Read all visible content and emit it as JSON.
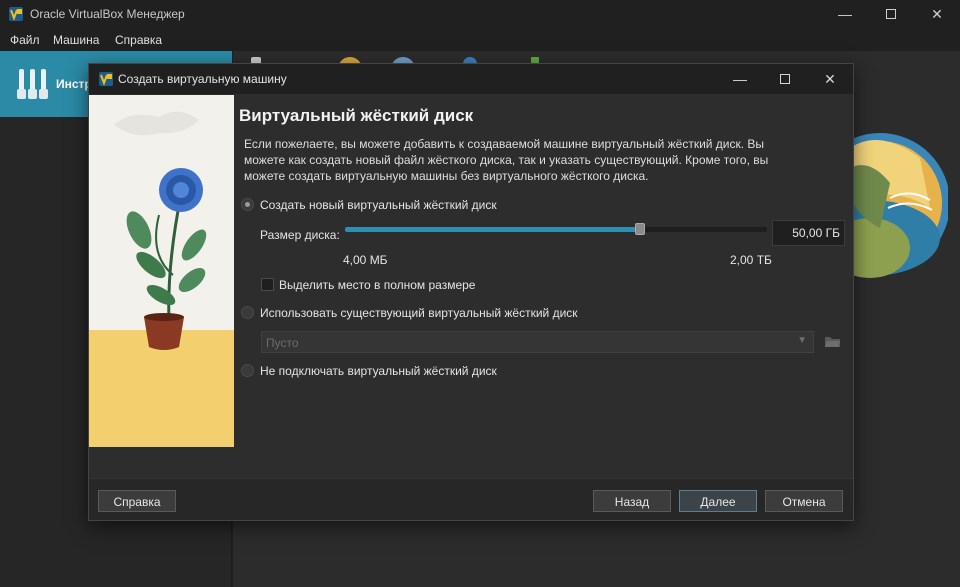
{
  "window": {
    "title": "Oracle VirtualBox Менеджер",
    "minimize_icon": "minimize-icon",
    "maximize_icon": "maximize-icon",
    "close_icon": "close-icon"
  },
  "menu": [
    "Файл",
    "Машина",
    "Справка"
  ],
  "sidebar": {
    "tools_label": "Инстр"
  },
  "dialog": {
    "title": "Создать виртуальную машину",
    "heading": "Виртуальный жёсткий диск",
    "description": "Если пожелаете, вы можете добавить к создаваемой машине виртуальный жёсткий диск. Вы можете как создать новый файл жёсткого диска, так и указать существующий. Кроме того, вы можете создать виртуальную машины без виртуального жёсткого диска.",
    "option_create": "Создать новый виртуальный жёсткий диск",
    "size_label": "Размер диска:",
    "size_value": "50,00 ГБ",
    "size_min": "4,00 МБ",
    "size_max": "2,00 ТБ",
    "slider_fraction": 0.7,
    "preallocate_label": "Выделить место в полном размере",
    "option_existing": "Использовать существующий виртуальный жёсткий диск",
    "existing_select_value": "Пусто",
    "option_none": "Не подключать виртуальный жёсткий диск",
    "selected_option": "create",
    "buttons": {
      "help": "Справка",
      "back": "Назад",
      "next": "Далее",
      "cancel": "Отмена"
    }
  },
  "colors": {
    "accent": "#2b8aa6",
    "slider_fill": "#2f8fb0"
  }
}
